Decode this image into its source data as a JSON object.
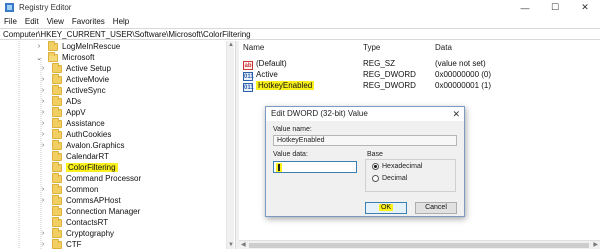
{
  "window": {
    "title": "Registry Editor",
    "controls": {
      "minimize": "—",
      "maximize": "☐",
      "close": "✕"
    }
  },
  "menu": [
    "File",
    "Edit",
    "View",
    "Favorites",
    "Help"
  ],
  "address": "Computer\\HKEY_CURRENT_USER\\Software\\Microsoft\\ColorFiltering",
  "tree": {
    "items": [
      {
        "label": "LogMeInRescue",
        "expander": "›",
        "highlight": false
      },
      {
        "label": "Microsoft",
        "expander": "⌄",
        "highlight": false
      },
      {
        "label": "Active Setup",
        "expander": "›",
        "highlight": false
      },
      {
        "label": "ActiveMovie",
        "expander": "›",
        "highlight": false
      },
      {
        "label": "ActiveSync",
        "expander": "›",
        "highlight": false
      },
      {
        "label": "ADs",
        "expander": "›",
        "highlight": false
      },
      {
        "label": "AppV",
        "expander": "›",
        "highlight": false
      },
      {
        "label": "Assistance",
        "expander": "›",
        "highlight": false
      },
      {
        "label": "AuthCookies",
        "expander": "›",
        "highlight": false
      },
      {
        "label": "Avalon.Graphics",
        "expander": "›",
        "highlight": false
      },
      {
        "label": "CalendarRT",
        "expander": "",
        "highlight": false
      },
      {
        "label": "ColorFiltering",
        "expander": "",
        "highlight": true
      },
      {
        "label": "Command Processor",
        "expander": "",
        "highlight": false
      },
      {
        "label": "Common",
        "expander": "›",
        "highlight": false
      },
      {
        "label": "CommsAPHost",
        "expander": "›",
        "highlight": false
      },
      {
        "label": "Connection Manager",
        "expander": "",
        "highlight": false
      },
      {
        "label": "ContactsRT",
        "expander": "",
        "highlight": false
      },
      {
        "label": "Cryptography",
        "expander": "›",
        "highlight": false
      },
      {
        "label": "CTF",
        "expander": "›",
        "highlight": false
      }
    ]
  },
  "list": {
    "headers": {
      "name": "Name",
      "type": "Type",
      "data": "Data"
    },
    "rows": [
      {
        "icon": "ab",
        "name": "(Default)",
        "type": "REG_SZ",
        "data": "(value not set)",
        "highlight": false
      },
      {
        "icon": "011",
        "name": "Active",
        "type": "REG_DWORD",
        "data": "0x00000000 (0)",
        "highlight": false
      },
      {
        "icon": "011",
        "name": "HotkeyEnabled",
        "type": "REG_DWORD",
        "data": "0x00000001 (1)",
        "highlight": true
      }
    ]
  },
  "dialog": {
    "title": "Edit DWORD (32-bit) Value",
    "close": "✕",
    "value_name_label": "Value name:",
    "value_name": "HotkeyEnabled",
    "value_data_label": "Value data:",
    "value_data": "1",
    "base_label": "Base",
    "hex_label": "Hexadecimal",
    "dec_label": "Decimal",
    "base_selected": "Hexadecimal",
    "ok_label": "OK",
    "cancel_label": "Cancel"
  },
  "colors": {
    "highlight": "#f9f01c",
    "folder": "#f2cf63",
    "accent": "#3c7fb1"
  }
}
